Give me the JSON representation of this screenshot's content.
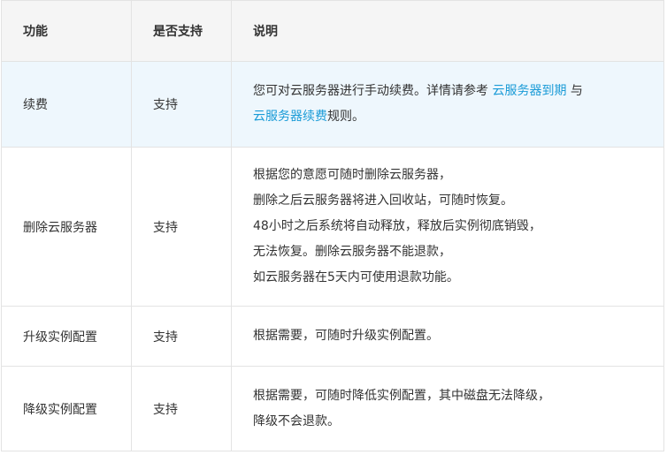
{
  "table": {
    "headers": [
      "功能",
      "是否支持",
      "说明"
    ],
    "rows": [
      {
        "feature": "续费",
        "support": "支持",
        "description": {
          "text_1": "您可对云服务器进行手动续费。详情请参考 ",
          "link_1": "云服务器到期",
          "text_2": " 与",
          "link_2": "云服务器续费",
          "text_3": "规则。"
        }
      },
      {
        "feature": "删除云服务器",
        "support": "支持",
        "description_lines": [
          "根据您的意愿可随时删除云服务器，",
          "删除之后云服务器将进入回收站，可随时恢复。",
          "48小时之后系统将自动释放，释放后实例彻底销毁，",
          "无法恢复。删除云服务器不能退款，",
          "如云服务器在5天内可使用退款功能。"
        ]
      },
      {
        "feature": "升级实例配置",
        "support": "支持",
        "description_lines": [
          "根据需要，可随时升级实例配置。"
        ]
      },
      {
        "feature": "降级实例配置",
        "support": "支持",
        "description_lines": [
          "根据需要，可随时降低实例配置，其中磁盘无法降级，",
          "降级不会退款。"
        ]
      }
    ]
  },
  "colors": {
    "header_bg": "#f5f5f5",
    "highlight_row_bg": "#eef7fd",
    "link": "#1a9bd7",
    "border": "#e3e3e3",
    "text": "#333333"
  }
}
